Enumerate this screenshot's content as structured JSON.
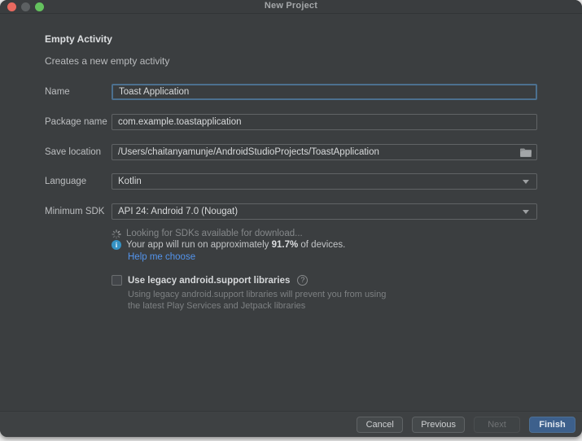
{
  "window": {
    "title": "New Project"
  },
  "header": {
    "title": "Empty Activity",
    "subtitle": "Creates a new empty activity"
  },
  "form": {
    "name": {
      "label": "Name",
      "value": "Toast Application"
    },
    "package": {
      "label": "Package name",
      "value": "com.example.toastapplication"
    },
    "save_location": {
      "label": "Save location",
      "value": "/Users/chaitanyamunje/AndroidStudioProjects/ToastApplication"
    },
    "language": {
      "label": "Language",
      "value": "Kotlin"
    },
    "min_sdk": {
      "label": "Minimum SDK",
      "value": "API 24: Android 7.0 (Nougat)"
    }
  },
  "sdk_info": {
    "loading_text": "Looking for SDKs available for download...",
    "coverage_prefix": "Your app will run on approximately ",
    "coverage_percent": "91.7%",
    "coverage_suffix": " of devices.",
    "help_link": "Help me choose"
  },
  "legacy": {
    "checkbox_label": "Use legacy android.support libraries",
    "checked": false,
    "help_icon": "?",
    "helper_line1": "Using legacy android.support libraries will prevent you from using",
    "helper_line2": "the latest Play Services and Jetpack libraries"
  },
  "footer": {
    "cancel": "Cancel",
    "previous": "Previous",
    "next": "Next",
    "finish": "Finish"
  },
  "colors": {
    "dialog_bg": "#3b3e40",
    "focus_border": "#4c708f",
    "link_blue": "#5394ec",
    "info_blue": "#3592c4",
    "finish_bg": "#3d608c",
    "traffic_red": "#e8695f",
    "traffic_gray": "#5c6062",
    "traffic_green": "#64c25e"
  }
}
